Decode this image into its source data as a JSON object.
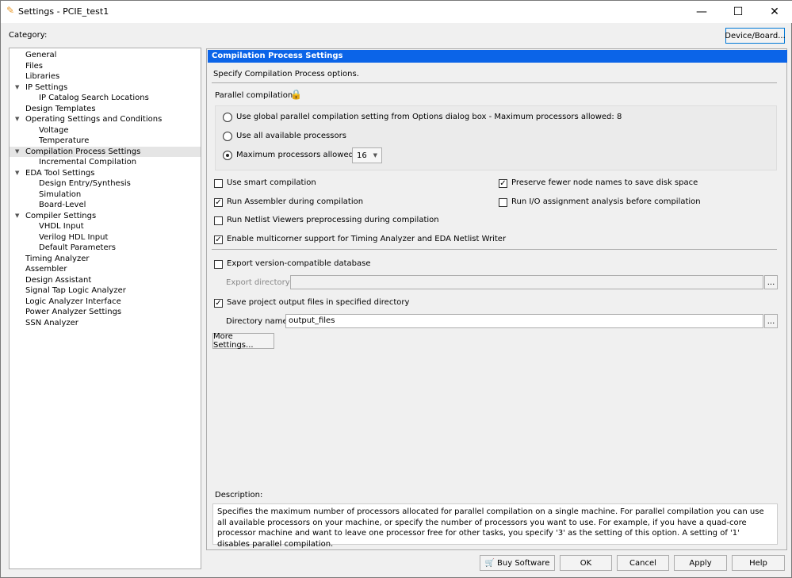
{
  "window": {
    "title": "Settings - PCIE_test1",
    "icon": "pencil-icon",
    "minimize": "—",
    "maximize": "☐",
    "close": "✕"
  },
  "category_label": "Category:",
  "device_board_button": "Device/Board...",
  "tree": [
    {
      "label": "General",
      "level": 0
    },
    {
      "label": "Files",
      "level": 0
    },
    {
      "label": "Libraries",
      "level": 0
    },
    {
      "label": "IP Settings",
      "level": 0,
      "expanded": true
    },
    {
      "label": "IP Catalog Search Locations",
      "level": 1
    },
    {
      "label": "Design Templates",
      "level": 0
    },
    {
      "label": "Operating Settings and Conditions",
      "level": 0,
      "expanded": true
    },
    {
      "label": "Voltage",
      "level": 1
    },
    {
      "label": "Temperature",
      "level": 1
    },
    {
      "label": "Compilation Process Settings",
      "level": 0,
      "expanded": true,
      "selected": true
    },
    {
      "label": "Incremental Compilation",
      "level": 1
    },
    {
      "label": "EDA Tool Settings",
      "level": 0,
      "expanded": true
    },
    {
      "label": "Design Entry/Synthesis",
      "level": 1
    },
    {
      "label": "Simulation",
      "level": 1
    },
    {
      "label": "Board-Level",
      "level": 1
    },
    {
      "label": "Compiler Settings",
      "level": 0,
      "expanded": true
    },
    {
      "label": "VHDL Input",
      "level": 1
    },
    {
      "label": "Verilog HDL Input",
      "level": 1
    },
    {
      "label": "Default Parameters",
      "level": 1
    },
    {
      "label": "Timing Analyzer",
      "level": 0
    },
    {
      "label": "Assembler",
      "level": 0
    },
    {
      "label": "Design Assistant",
      "level": 0
    },
    {
      "label": "Signal Tap Logic Analyzer",
      "level": 0
    },
    {
      "label": "Logic Analyzer Interface",
      "level": 0
    },
    {
      "label": "Power Analyzer Settings",
      "level": 0
    },
    {
      "label": "SSN Analyzer",
      "level": 0
    }
  ],
  "panel": {
    "header": "Compilation Process Settings",
    "header_color": "#0b64e8",
    "intro": "Specify Compilation Process options.",
    "parallel": {
      "label": "Parallel compilation",
      "lock_icon": "lock-icon",
      "options": [
        {
          "label": "Use global parallel compilation setting from Options dialog box - Maximum processors allowed: 8",
          "selected": false
        },
        {
          "label": "Use all available processors",
          "selected": false
        },
        {
          "label": "Maximum processors allowed:",
          "selected": true
        }
      ],
      "max_value": "16"
    },
    "checks": [
      {
        "label": "Use smart compilation",
        "checked": false
      },
      {
        "label": "Preserve fewer node names to save disk space",
        "checked": true
      },
      {
        "label": "Run Assembler during compilation",
        "checked": true
      },
      {
        "label": "Run I/O assignment analysis before compilation",
        "checked": false
      },
      {
        "label": "Run Netlist Viewers preprocessing during compilation",
        "checked": false
      },
      {
        "label": "Enable multicorner support for Timing Analyzer and EDA Netlist Writer",
        "checked": true
      },
      {
        "label": "Export version-compatible database",
        "checked": false
      },
      {
        "label": "Save project output files in specified directory",
        "checked": true
      }
    ],
    "export_dir_label": "Export directory:",
    "export_dir_value": "",
    "dir_name_label": "Directory name:",
    "dir_name_value": "output_files",
    "browse": "...",
    "more_settings": "More Settings...",
    "description_label": "Description:",
    "description": "Specifies the maximum number of processors allocated for parallel compilation on a single machine. For parallel compilation you can use all available processors on your machine, or specify the number of processors you want to use. For example, if you have a quad-core processor machine and want to leave one processor free for other tasks, you specify '3' as the setting of this option. A setting of '1' disables parallel compilation."
  },
  "buttons": {
    "buy": "Buy Software",
    "ok": "OK",
    "cancel": "Cancel",
    "apply": "Apply",
    "help": "Help"
  }
}
